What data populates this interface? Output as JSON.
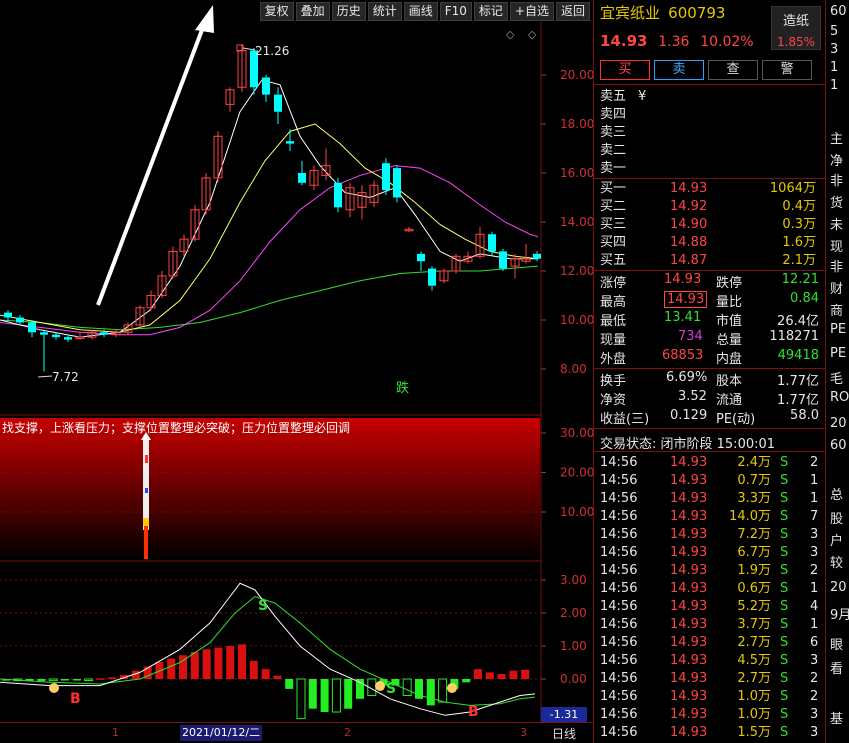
{
  "toolbar": {
    "buttons": [
      "复权",
      "叠加",
      "历史",
      "统计",
      "画线",
      "F10",
      "标记",
      "+自选",
      "返回"
    ]
  },
  "main_chart": {
    "icons": [
      "◇",
      "◇"
    ],
    "high_label": "21.26",
    "low_label": "7.72",
    "down_label": "跌",
    "y_ticks": [
      "20.00",
      "18.00",
      "16.00",
      "14.00",
      "12.00",
      "10.00",
      "8.00"
    ]
  },
  "indicator": {
    "header_text": "找支撑，上涨看压力；支撑位置整理必突破；压力位置整理必回调",
    "y_ticks": [
      "30.00",
      "20.00",
      "10.00"
    ]
  },
  "macd": {
    "y_ticks": [
      "3.00",
      "2.00",
      "1.00",
      "0.00"
    ],
    "value_box": "-1.31",
    "labels": {
      "s1": "S",
      "b1": "B",
      "s2": "S",
      "b2": "B"
    }
  },
  "date_bar": {
    "selected_date": "2021/01/12/二",
    "marks": [
      "1",
      "2",
      "3"
    ],
    "period": "日线"
  },
  "quote": {
    "stock_name": "宜宾纸业",
    "stock_code": "600793",
    "price": "14.93",
    "change": "1.36",
    "change_pct": "10.02%",
    "concept": {
      "name": "造纸",
      "pct": "1.85%"
    },
    "trade_buttons": {
      "buy": "买",
      "sell": "卖",
      "query": "查",
      "alert": "警"
    },
    "asks": [
      {
        "label": "卖五",
        "price": "¥",
        "vol": ""
      },
      {
        "label": "卖四",
        "price": "",
        "vol": ""
      },
      {
        "label": "卖三",
        "price": "",
        "vol": ""
      },
      {
        "label": "卖二",
        "price": "",
        "vol": ""
      },
      {
        "label": "卖一",
        "price": "",
        "vol": ""
      }
    ],
    "bids": [
      {
        "label": "买一",
        "price": "14.93",
        "vol": "1064万"
      },
      {
        "label": "买二",
        "price": "14.92",
        "vol": "0.4万"
      },
      {
        "label": "买三",
        "price": "14.90",
        "vol": "0.3万"
      },
      {
        "label": "买四",
        "price": "14.88",
        "vol": "1.6万"
      },
      {
        "label": "买五",
        "price": "14.87",
        "vol": "2.1万"
      }
    ],
    "stats": {
      "limit_up_label": "涨停",
      "limit_up": "14.93",
      "limit_down_label": "跌停",
      "limit_down": "12.21",
      "high_label": "最高",
      "high": "14.93",
      "vol_ratio_label": "量比",
      "vol_ratio": "0.84",
      "low_label": "最低",
      "low": "13.41",
      "mkt_cap_label": "市值",
      "mkt_cap": "26.4亿",
      "cur_vol_label": "现量",
      "cur_vol": "734",
      "total_vol_label": "总量",
      "total_vol": "118271",
      "outer_label": "外盘",
      "outer": "68853",
      "inner_label": "内盘",
      "inner": "49418",
      "turnover_label": "换手",
      "turnover": "6.69%",
      "shares_label": "股本",
      "shares": "1.77亿",
      "nav_label": "净资",
      "nav": "3.52",
      "float_label": "流通",
      "float": "1.77亿",
      "eps_label": "收益(三)",
      "eps": "0.129",
      "pe_label": "PE(动)",
      "pe": "58.0"
    },
    "tape_header": "交易状态: 闭市阶段 15:00:01",
    "tape": [
      {
        "time": "14:56",
        "price": "14.93",
        "vol": "2.4万",
        "side": "S",
        "cnt": "2"
      },
      {
        "time": "14:56",
        "price": "14.93",
        "vol": "0.7万",
        "side": "S",
        "cnt": "1"
      },
      {
        "time": "14:56",
        "price": "14.93",
        "vol": "3.3万",
        "side": "S",
        "cnt": "1"
      },
      {
        "time": "14:56",
        "price": "14.93",
        "vol": "14.0万",
        "side": "S",
        "cnt": "7"
      },
      {
        "time": "14:56",
        "price": "14.93",
        "vol": "7.2万",
        "side": "S",
        "cnt": "3"
      },
      {
        "time": "14:56",
        "price": "14.93",
        "vol": "6.7万",
        "side": "S",
        "cnt": "3"
      },
      {
        "time": "14:56",
        "price": "14.93",
        "vol": "1.9万",
        "side": "S",
        "cnt": "2"
      },
      {
        "time": "14:56",
        "price": "14.93",
        "vol": "0.6万",
        "side": "S",
        "cnt": "1"
      },
      {
        "time": "14:56",
        "price": "14.93",
        "vol": "5.2万",
        "side": "S",
        "cnt": "4"
      },
      {
        "time": "14:56",
        "price": "14.93",
        "vol": "3.7万",
        "side": "S",
        "cnt": "1"
      },
      {
        "time": "14:56",
        "price": "14.93",
        "vol": "2.7万",
        "side": "S",
        "cnt": "6"
      },
      {
        "time": "14:56",
        "price": "14.93",
        "vol": "4.5万",
        "side": "S",
        "cnt": "3"
      },
      {
        "time": "14:56",
        "price": "14.93",
        "vol": "2.7万",
        "side": "S",
        "cnt": "2"
      },
      {
        "time": "14:56",
        "price": "14.93",
        "vol": "1.0万",
        "side": "S",
        "cnt": "2"
      },
      {
        "time": "14:56",
        "price": "14.93",
        "vol": "1.0万",
        "side": "S",
        "cnt": "3"
      },
      {
        "time": "14:56",
        "price": "14.93",
        "vol": "1.5万",
        "side": "S",
        "cnt": "3"
      }
    ]
  },
  "side_sliver": {
    "items": [
      "60",
      "5",
      "3",
      "1",
      "1",
      "主",
      "净",
      "非",
      "货",
      "未",
      "现",
      "非",
      "财",
      "商",
      "PE",
      "PE",
      "毛",
      "RO",
      "20",
      "60",
      "总",
      "股",
      "户",
      "较",
      "20",
      "9月",
      "眼",
      "看",
      "基"
    ]
  },
  "colors": {
    "up": "#ff4545",
    "down": "#2ee02e",
    "cyan": "#00ffff",
    "ma5": "#ffffff",
    "ma10": "#ffff66",
    "ma20": "#ff44ff",
    "ma60": "#33dd33"
  }
}
